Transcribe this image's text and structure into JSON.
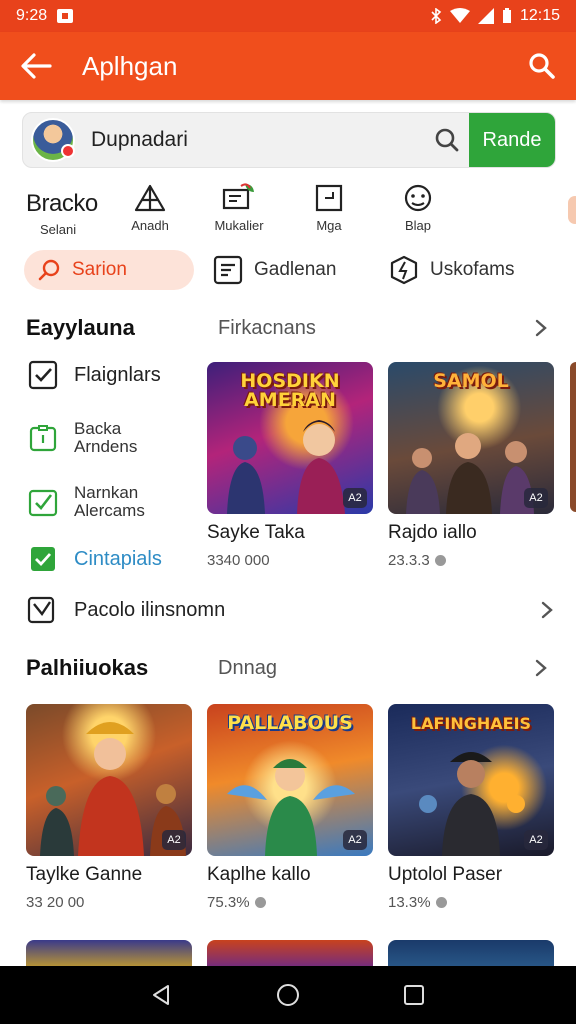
{
  "status": {
    "time": "9:28",
    "right_time": "12:15"
  },
  "app_bar": {
    "title": "Aplhgan"
  },
  "search": {
    "value": "Dupnadari",
    "button_label": "Rande"
  },
  "quick": {
    "brand_title": "Bracko",
    "brand_sub": "Selani",
    "items": [
      {
        "label": "Anadh",
        "icon": "tent-icon"
      },
      {
        "label": "Mukalier",
        "icon": "media-icon"
      },
      {
        "label": "Mga",
        "icon": "note-icon"
      },
      {
        "label": "Blap",
        "icon": "face-icon"
      }
    ]
  },
  "chips": [
    {
      "label": "Sarion",
      "icon": "search-icon"
    },
    {
      "label": "Gadlenan",
      "icon": "list-icon"
    },
    {
      "label": "Uskofams",
      "icon": "bolt-icon"
    }
  ],
  "section1": {
    "title": "Eayylauna",
    "sub": "Firkacnans"
  },
  "check_items": [
    {
      "label": "Flaignlars"
    },
    {
      "label_line1": "Backa",
      "label_line2": "Arndens"
    },
    {
      "label_line1": "Narnkan",
      "label_line2": "Alercams"
    },
    {
      "label": "Cintapials"
    }
  ],
  "wide_row": {
    "label": "Pacolo ilinsnomn"
  },
  "cards_row1": [
    {
      "art": "HOSDIKN AMERAN",
      "name": "Sayke Taka",
      "meta": "3340 000",
      "show_dot": false
    },
    {
      "art": "SAMOL",
      "name": "Rajdo iallo",
      "meta": "23.3.3",
      "show_dot": true
    }
  ],
  "section2": {
    "title": "Palhiiuokas",
    "sub": "Dnnag"
  },
  "cards_row2": [
    {
      "art": "",
      "name": "Taylke Ganne",
      "meta": "33 20 00",
      "show_dot": false
    },
    {
      "art": "PALLABOUS",
      "name": "Kaplhe kallo",
      "meta": "75.3%",
      "show_dot": true
    },
    {
      "art": "LAFINGHAEIS",
      "name": "Uptolol Paser",
      "meta": "13.3%",
      "show_dot": true
    }
  ],
  "badge_label": "A2"
}
